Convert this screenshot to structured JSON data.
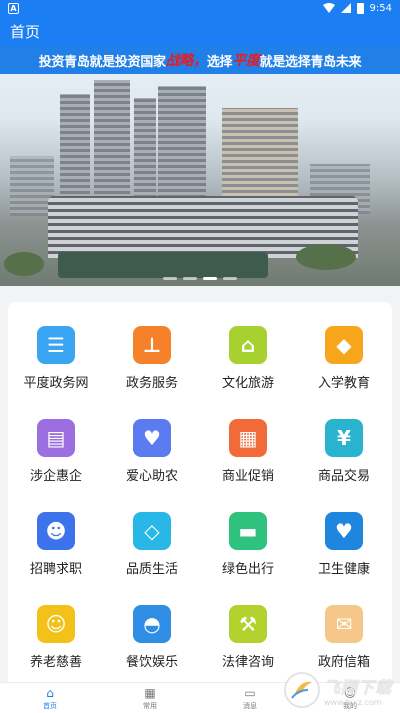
{
  "status_bar": {
    "carrier_badge": "A",
    "time": "9:54"
  },
  "header": {
    "title": "首页"
  },
  "banner": {
    "slogan_parts": [
      "投资青岛就是投资国家",
      "战略，",
      "选择",
      "平度",
      "就是选择青岛未来"
    ],
    "slide_count": 4,
    "active_slide": 3
  },
  "grid": {
    "items": [
      {
        "label": "平度政务网",
        "icon": "clipboard-icon",
        "color": "#3aa5f2"
      },
      {
        "label": "政务服务",
        "icon": "stamp-icon",
        "color": "#f5822a"
      },
      {
        "label": "文化旅游",
        "icon": "beach-chair-icon",
        "color": "#a6d12e"
      },
      {
        "label": "入学教育",
        "icon": "graduation-cap-icon",
        "color": "#f7a51d"
      },
      {
        "label": "涉企惠企",
        "icon": "document-icon",
        "color": "#9b6fe0"
      },
      {
        "label": "爱心助农",
        "icon": "heart-hand-icon",
        "color": "#5a7cf0"
      },
      {
        "label": "商业促销",
        "icon": "building-icon",
        "color": "#f26a3a"
      },
      {
        "label": "商品交易",
        "icon": "yen-book-icon",
        "color": "#29b3cf"
      },
      {
        "label": "招聘求职",
        "icon": "person-icon",
        "color": "#3d73ea"
      },
      {
        "label": "品质生活",
        "icon": "diamond-icon",
        "color": "#29b7e8"
      },
      {
        "label": "绿色出行",
        "icon": "car-icon",
        "color": "#2ec27e"
      },
      {
        "label": "卫生健康",
        "icon": "heart-pulse-icon",
        "color": "#1f86e0"
      },
      {
        "label": "养老慈善",
        "icon": "elder-icon",
        "color": "#f2c21b"
      },
      {
        "label": "餐饮娱乐",
        "icon": "food-cloche-icon",
        "color": "#2f8de4"
      },
      {
        "label": "法律咨询",
        "icon": "gavel-icon",
        "color": "#b4d22f"
      },
      {
        "label": "政府信箱",
        "icon": "mailbox-icon",
        "color": "#f5c78b"
      }
    ]
  },
  "tabbar": {
    "tabs": [
      {
        "label": "首页",
        "icon": "home-icon"
      },
      {
        "label": "常用",
        "icon": "apps-icon"
      },
      {
        "label": "消息",
        "icon": "message-icon"
      },
      {
        "label": "我的",
        "icon": "user-icon"
      }
    ]
  },
  "watermark": {
    "title": "飞翔下载",
    "url": "www.fxxz.com"
  }
}
